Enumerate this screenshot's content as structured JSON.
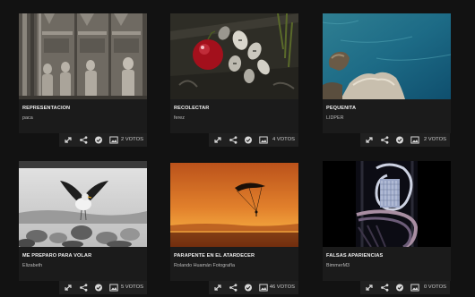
{
  "gallery": {
    "items": [
      {
        "title": "REPRESENTACIÓN",
        "author": "paca",
        "votes": "2 VOTOS",
        "image": "cathedral-saint-statues"
      },
      {
        "title": "RECOLECTAR",
        "author": "ferez",
        "votes": "4 VOTOS",
        "image": "red-berry-among-seeds"
      },
      {
        "title": "PEQUEÑITA",
        "author": "LIDPER",
        "votes": "2 VOTOS",
        "image": "rocky-coast-blue-sea"
      },
      {
        "title": "ME PREPARO PARA VOLAR",
        "author": "Elizabeth",
        "votes": "5 VOTOS",
        "image": "seagull-on-rocks"
      },
      {
        "title": "PARAPENTE EN EL ATARDECER",
        "author": "Rolando Huamán Fotografía",
        "votes": "46 VOTOS",
        "image": "paraglider-orange-sunset"
      },
      {
        "title": "FALSAS APARIENCIAS",
        "author": "BimmerM3",
        "votes": "0 VOTOS",
        "image": "spiral-staircase-skyscraper"
      }
    ]
  },
  "actions": {
    "expand": "expand-icon",
    "share": "share-icon",
    "vote": "check-circle-icon",
    "view": "image-view-icon"
  }
}
